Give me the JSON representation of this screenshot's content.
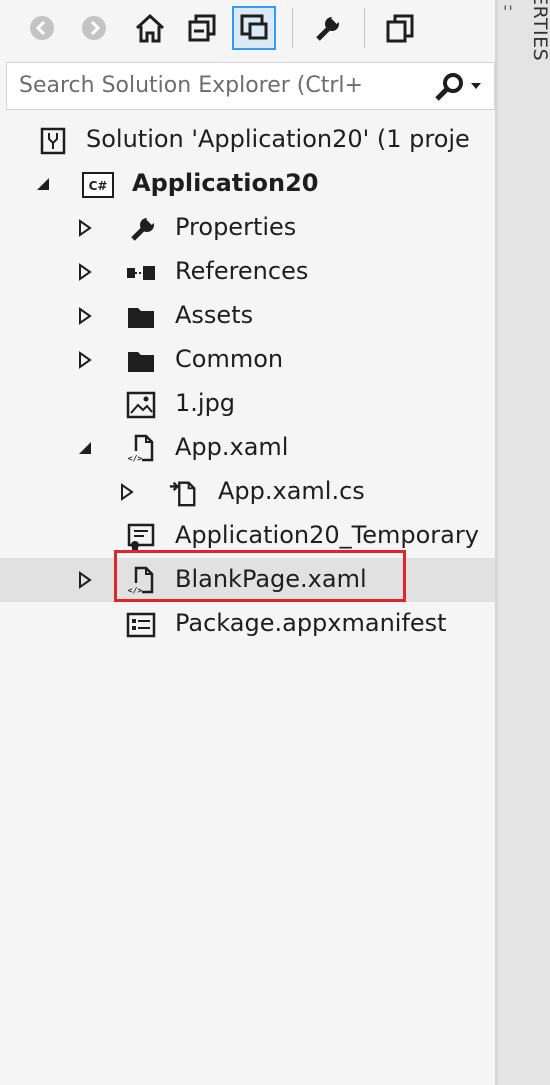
{
  "toolbar": {
    "buttons": [
      {
        "name": "back-icon"
      },
      {
        "name": "forward-icon"
      },
      {
        "name": "home-icon"
      },
      {
        "name": "collapse-all-icon"
      },
      {
        "name": "sync-view-icon",
        "active": true
      },
      {
        "name": "properties-wrench-icon"
      },
      {
        "name": "show-all-files-icon"
      }
    ]
  },
  "search": {
    "placeholder": "Search Solution Explorer (Ctrl+"
  },
  "right_panel": {
    "tab_label": "PROPERTIES",
    "menu_glyph": "''"
  },
  "tree": {
    "solution": "Solution 'Application20' (1 proje",
    "project": "Application20",
    "project_badge": "C#",
    "items": [
      {
        "label": "Properties",
        "icon": "wrench-icon"
      },
      {
        "label": "References",
        "icon": "references-icon"
      },
      {
        "label": "Assets",
        "icon": "folder-icon"
      },
      {
        "label": "Common",
        "icon": "folder-icon"
      },
      {
        "label": "1.jpg",
        "icon": "image-icon"
      },
      {
        "label": "App.xaml",
        "icon": "xaml-file-icon"
      },
      {
        "label": "App.xaml.cs",
        "icon": "cs-file-icon"
      },
      {
        "label": "Application20_Temporary",
        "icon": "certificate-icon"
      },
      {
        "label": "BlankPage.xaml",
        "icon": "xaml-file-icon",
        "selected": true
      },
      {
        "label": "Package.appxmanifest",
        "icon": "manifest-icon"
      }
    ]
  },
  "colors": {
    "highlight": "#e3242b",
    "selection": "#e1e1e1",
    "accent": "#3399ff"
  }
}
